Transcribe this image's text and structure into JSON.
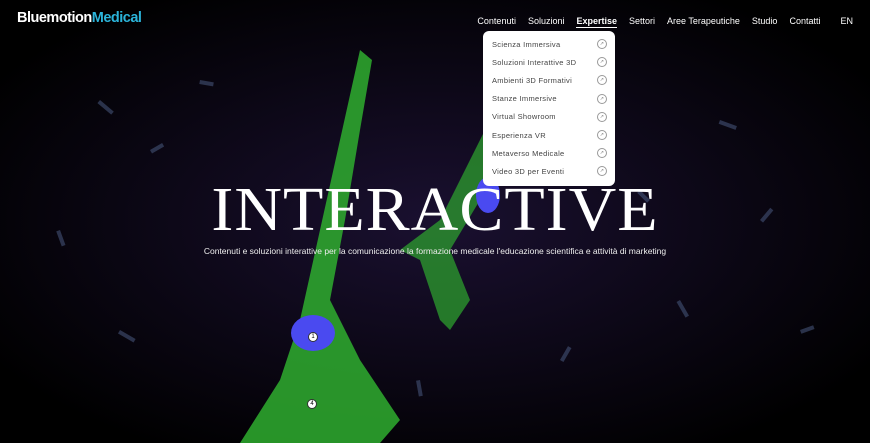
{
  "brand": {
    "part1": "Bluemotion",
    "part2": "Medical"
  },
  "nav": {
    "items": [
      "Contenuti",
      "Soluzioni",
      "Expertise",
      "Settori",
      "Aree Terapeutiche",
      "Studio",
      "Contatti"
    ],
    "active": "Expertise",
    "lang": "EN"
  },
  "dropdown": {
    "items": [
      "Scienza Immersiva",
      "Soluzioni Interattive 3D",
      "Ambienti 3D Formativi",
      "Stanze Immersive",
      "Virtual Showroom",
      "Esperienza VR",
      "Metaverso Medicale",
      "Video 3D per Eventi"
    ],
    "icon": "arrow-up-right-circle-icon"
  },
  "hero": {
    "title": "INTERACTIVE",
    "subtitle": "Contenuti e soluzioni interattive per la comunicazione la formazione medicale l'educazione scientifica e attività di marketing"
  },
  "hotspots": [
    "1",
    "4"
  ],
  "colors": {
    "accent": "#2bb3d9",
    "cell": "#3cd23c",
    "nucleus": "#4a4af0"
  }
}
